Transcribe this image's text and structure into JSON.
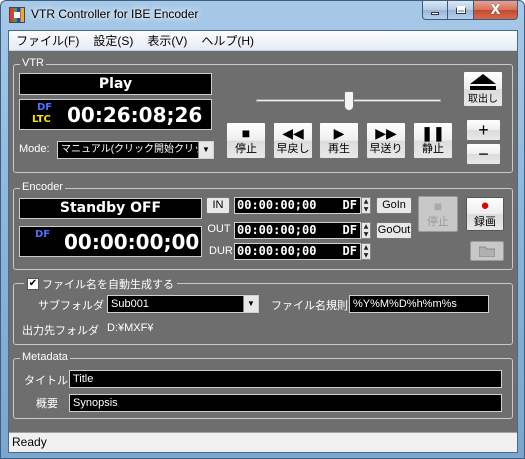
{
  "window": {
    "title": "VTR Controller for IBE Encoder",
    "caption": {
      "minimize": "–",
      "maximize": "□",
      "close": "X"
    }
  },
  "menu": [
    "ファイル(F)",
    "設定(S)",
    "表示(V)",
    "ヘルプ(H)"
  ],
  "vtr": {
    "group_label": "VTR",
    "status": "Play",
    "df": "DF",
    "ltc": "LTC",
    "timecode": "00:26:08;26",
    "mode_label": "Mode:",
    "mode_value": "マニュアル(クリック開始クリック終了",
    "eject_label": "取出し",
    "shuttle_level": 0.5,
    "buttons": {
      "stop": "停止",
      "rewind": "早戻し",
      "play": "再生",
      "ff": "早送り",
      "pause": "静止"
    },
    "plus": "+",
    "minus": "−"
  },
  "encoder": {
    "group_label": "Encoder",
    "status": "Standby OFF",
    "df": "DF",
    "timecode": "00:00:00;00",
    "in_label": "IN",
    "out_label": "OUT",
    "dur_label": "DUR",
    "in_value": "00:00:00;00",
    "out_value": "00:00:00;00",
    "dur_value": "00:00:00;00",
    "df_suffix": "DF",
    "goin": "GoIn",
    "goout": "GoOut",
    "stop": "停止",
    "record": "録画",
    "record_color": "#e00000"
  },
  "filename": {
    "auto_label": "ファイル名を自動生成する",
    "auto_checked": true,
    "subfolder_label": "サブフォルダ",
    "subfolder_value": "Sub001",
    "rule_label": "ファイル名規則",
    "rule_value": "%Y%M%D%h%m%s",
    "output_label": "出力先フォルダ",
    "output_value": "D:¥MXF¥"
  },
  "metadata": {
    "group_label": "Metadata",
    "title_label": "タイトル",
    "title_value": "Title",
    "summary_label": "概要",
    "summary_value": "Synopsis"
  },
  "status_bar": "Ready",
  "colors": {
    "panel": "#6e6e6e",
    "df_blue": "#4f6fff",
    "ltc_yellow": "#ffe000"
  }
}
